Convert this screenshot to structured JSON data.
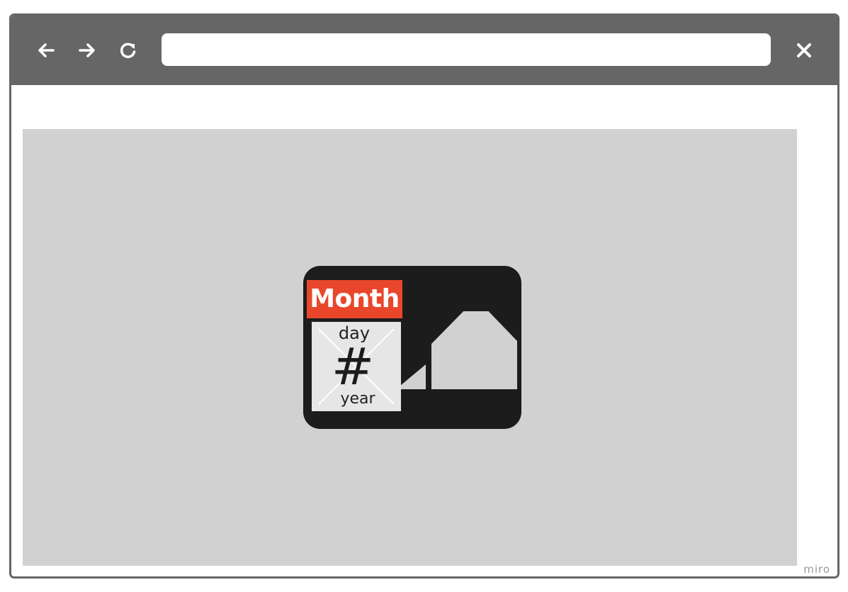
{
  "browser": {
    "address_value": "",
    "icons": {
      "back": "arrow-left-icon",
      "forward": "arrow-right-icon",
      "reload": "reload-icon",
      "close": "close-icon"
    },
    "colors": {
      "chrome": "#666666",
      "viewport": "#d1d1d1"
    }
  },
  "content": {
    "calendar": {
      "month_label": "Month",
      "day_label": "day",
      "date_symbol": "#",
      "year_label": "year",
      "colors": {
        "card": "#1c1c1c",
        "month_header": "#e8472b",
        "date_box": "#e6e6e6",
        "house": "#d1d1d1"
      }
    }
  },
  "watermark": "miro"
}
